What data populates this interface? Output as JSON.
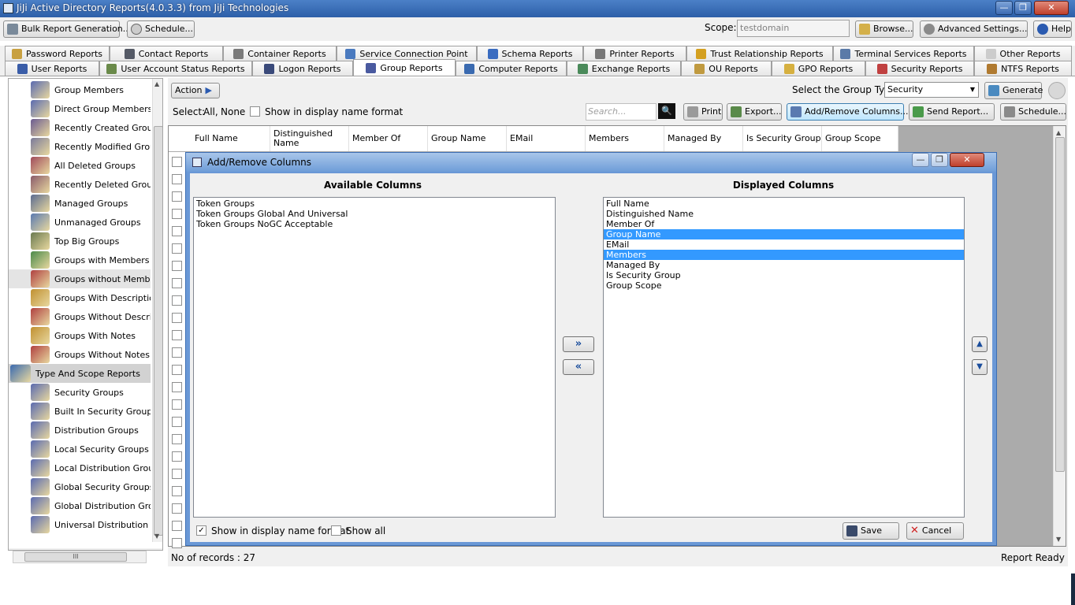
{
  "window": {
    "title": "JiJi Active Directory Reports(4.0.3.3) from JiJi Technologies",
    "minimize": "—",
    "restore": "❐",
    "close": "✕"
  },
  "toolbar": {
    "bulk_report": "Bulk Report Generation...",
    "schedule": "Schedule...",
    "scope_label": "Scope:",
    "scope_value": "testdomain",
    "browse": "Browse...",
    "advanced_settings": "Advanced  Settings...",
    "help": "Help"
  },
  "tabs_row1": [
    {
      "label": "Password Reports",
      "color": "#c8a040"
    },
    {
      "label": "Contact Reports",
      "color": "#555a66"
    },
    {
      "label": "Container Reports",
      "color": "#7a7a7a"
    },
    {
      "label": "Service Connection Point",
      "color": "#4a7abf"
    },
    {
      "label": "Schema Reports",
      "color": "#3a6cc0"
    },
    {
      "label": "Printer Reports",
      "color": "#777777"
    },
    {
      "label": "Trust Relationship Reports",
      "color": "#d4a020"
    },
    {
      "label": "Terminal Services Reports",
      "color": "#5a7aa8"
    },
    {
      "label": "Other Reports",
      "color": "#cccccc"
    }
  ],
  "tabs_row2": [
    {
      "label": "User Reports",
      "color": "#3a5da8"
    },
    {
      "label": "User Account Status Reports",
      "color": "#6a8a4a"
    },
    {
      "label": "Logon Reports",
      "color": "#3a4a7a"
    },
    {
      "label": "Group Reports",
      "color": "#4a5aa0"
    },
    {
      "label": "Computer Reports",
      "color": "#3a6ab0"
    },
    {
      "label": "Exchange Reports",
      "color": "#4a8a5a"
    },
    {
      "label": "OU Reports",
      "color": "#c09a40"
    },
    {
      "label": "GPO Reports",
      "color": "#d6b040"
    },
    {
      "label": "Security Reports",
      "color": "#c04040"
    },
    {
      "label": "NTFS Reports",
      "color": "#b07a30"
    }
  ],
  "sidebar": {
    "items": [
      {
        "label": "Group Members",
        "color": "#5a6ab0"
      },
      {
        "label": "Direct Group Members",
        "color": "#5a6ab0"
      },
      {
        "label": "Recently Created Groups",
        "color": "#6a5a90"
      },
      {
        "label": "Recently Modified Groups",
        "color": "#7a7a9a"
      },
      {
        "label": "All Deleted Groups",
        "color": "#a04a5a"
      },
      {
        "label": "Recently Deleted Groups",
        "color": "#8a5a6a"
      },
      {
        "label": "Managed Groups",
        "color": "#5a6a90"
      },
      {
        "label": "Unmanaged Groups",
        "color": "#5a7ab0"
      },
      {
        "label": "Top Big Groups",
        "color": "#6a7a50"
      },
      {
        "label": "Groups with Members",
        "color": "#4a8a4a"
      },
      {
        "label": "Groups without Members",
        "color": "#b04040"
      },
      {
        "label": "Groups With Description",
        "color": "#c09030"
      },
      {
        "label": "Groups Without Description",
        "color": "#b04040"
      },
      {
        "label": "Groups With Notes",
        "color": "#c09030"
      },
      {
        "label": "Groups Without Notes",
        "color": "#b04040"
      },
      {
        "label": "Type And Scope Reports",
        "color": "#3a6ab0"
      },
      {
        "label": "Security Groups",
        "color": "#5a6ab0"
      },
      {
        "label": "Built In Security Groups",
        "color": "#5a6ab0"
      },
      {
        "label": "Distribution Groups",
        "color": "#5a6ab0"
      },
      {
        "label": "Local Security Groups",
        "color": "#5a6ab0"
      },
      {
        "label": "Local Distribution Groups",
        "color": "#5a6ab0"
      },
      {
        "label": "Global Security Groups",
        "color": "#5a6ab0"
      },
      {
        "label": "Global Distribution Groups",
        "color": "#5a6ab0"
      },
      {
        "label": "Universal Distribution Groups",
        "color": "#5a6ab0"
      }
    ],
    "scroll_h_label": "III"
  },
  "main": {
    "action": "Action",
    "group_type_label": "Select the Group Type:",
    "group_type_value": "Security",
    "generate": "Generate",
    "select_label": "Select:",
    "select_all": "All,",
    "select_none": "None",
    "display_name_format": "Show in display name format",
    "search_placeholder": "Search...",
    "print": "Print",
    "export": "Export...",
    "add_remove_columns": "Add/Remove Columns...",
    "send_report": "Send Report...",
    "schedule": "Schedule...",
    "columns": [
      "Full Name",
      "Distinguished Name",
      "Member Of",
      "Group Name",
      "EMail",
      "Members",
      "Managed By",
      "Is Security Group",
      "Group Scope"
    ],
    "records": "No of records : 27",
    "status": "Report Ready"
  },
  "dialog": {
    "title": "Add/Remove Columns",
    "available_header": "Available Columns",
    "displayed_header": "Displayed Columns",
    "available": [
      "Token Groups",
      "Token Groups Global And Universal",
      "Token Groups NoGC Acceptable"
    ],
    "displayed": [
      "Full Name",
      "Distinguished Name",
      "Member Of",
      "Group Name",
      "EMail",
      "Members",
      "Managed By",
      "Is Security Group",
      "Group Scope"
    ],
    "show_display_name": "Show in display name format",
    "show_display_name_checked": "✓",
    "show_all": "Show all",
    "save": "Save",
    "cancel": "Cancel",
    "add_arrow": "»",
    "remove_arrow": "«",
    "up": "▲",
    "down": "▼"
  }
}
